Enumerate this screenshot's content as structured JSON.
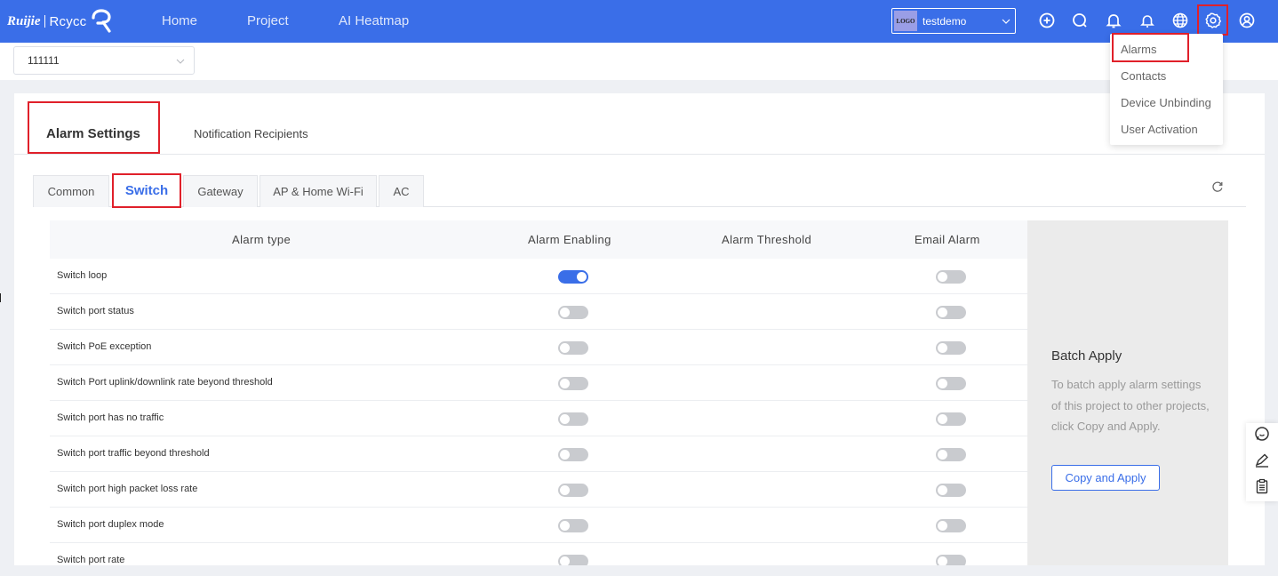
{
  "header": {
    "brand_left": "Ruijie",
    "brand_right": "Rcycc",
    "nav": [
      "Home",
      "Project",
      "AI Heatmap"
    ],
    "tenant_logo": "LOGO",
    "tenant_name": "testdemo"
  },
  "settings_menu": {
    "items": [
      "Alarms",
      "Contacts",
      "Device Unbinding",
      "User Activation"
    ]
  },
  "project_select": {
    "value": "111111"
  },
  "tabs": {
    "main": [
      "Alarm Settings",
      "Notification Recipients"
    ],
    "sub": [
      "Common",
      "Switch",
      "Gateway",
      "AP & Home Wi-Fi",
      "AC"
    ]
  },
  "table": {
    "headers": [
      "Alarm type",
      "Alarm Enabling",
      "Alarm Threshold",
      "Email Alarm"
    ],
    "rows": [
      {
        "name": "Switch loop",
        "enabled": true,
        "email": false
      },
      {
        "name": "Switch port status",
        "enabled": false,
        "email": false
      },
      {
        "name": "Switch PoE exception",
        "enabled": false,
        "email": false
      },
      {
        "name": "Switch Port uplink/downlink rate beyond threshold",
        "enabled": false,
        "email": false
      },
      {
        "name": "Switch port has no traffic",
        "enabled": false,
        "email": false
      },
      {
        "name": "Switch port traffic beyond threshold",
        "enabled": false,
        "email": false
      },
      {
        "name": "Switch port high packet loss rate",
        "enabled": false,
        "email": false
      },
      {
        "name": "Switch port duplex mode",
        "enabled": false,
        "email": false
      },
      {
        "name": "Switch port rate",
        "enabled": false,
        "email": false
      }
    ]
  },
  "batch": {
    "title": "Batch Apply",
    "description": "To batch apply alarm settings of this project to other projects, click Copy and Apply.",
    "button": "Copy and Apply"
  },
  "colors": {
    "primary": "#3a6ee8",
    "highlight": "#e0202a",
    "toggle_off": "#c9cbcf"
  }
}
